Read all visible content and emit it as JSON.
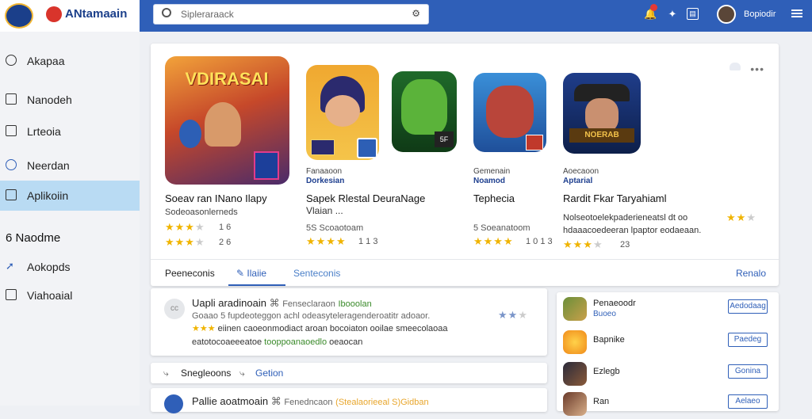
{
  "header": {
    "app_name": "ANtamaain",
    "search_placeholder": "Sipleraraack",
    "username": "Bopiodir",
    "icons": [
      "notification-bell-icon",
      "chat-icon",
      "inbox-icon",
      "menu-icon"
    ],
    "accent_color": "#2f5fb8"
  },
  "sidebar": {
    "items": [
      {
        "label": "Akapaa",
        "icon": "home-icon"
      },
      {
        "label": "Nanodeh",
        "icon": "grid-icon"
      },
      {
        "label": "Lrteoia",
        "icon": "list-icon"
      },
      {
        "label": "Neerdan",
        "icon": "clock-icon"
      },
      {
        "label": "Aplikoiin",
        "icon": "app-icon",
        "active": true
      }
    ],
    "section_heading": "6 Naodme",
    "section_items": [
      {
        "label": "Aokopds",
        "icon": "pin-icon"
      },
      {
        "label": "Viahoaial",
        "icon": "doc-icon"
      }
    ]
  },
  "featured": {
    "apps": [
      {
        "thumb_text": "VDIRASAI",
        "name": "Soeav ran INano Ilapy",
        "sub": "Sodeoasonlerneds",
        "stars_a": 3,
        "meta_a": "1  6",
        "stars_b": 3,
        "meta_b": "2  6"
      },
      {
        "t1": "Fanaaoon",
        "t2": "Dorkesian",
        "name": "Sapek Rlestal DeuraNage",
        "sub": "Vlaian ...",
        "meta_a": "5S  Scoaotoam",
        "stars_b": 4,
        "meta_b": "1  1  3"
      },
      {
        "t1": "Gemenain",
        "t2": "Noamod",
        "name": "Tephecia",
        "meta_a": "5  Soeanatoom",
        "stars_b": 4,
        "meta_b": "1  0  1  3"
      },
      {
        "t1": "Aoecaoon",
        "t2": "Aptarial",
        "name": "Rardit Fkar Taryahiaml",
        "sub": "Nolseotoelekpaderieneatsl dt  oo",
        "sub2": "hdaaacoedeeran lpaptor eodaeaan.",
        "stars_a": 2,
        "stars_b": 3,
        "meta_b": "23"
      }
    ],
    "tabs": [
      {
        "label": "Peeneconis"
      },
      {
        "label": "Ilaiie",
        "active": true
      },
      {
        "label": "Senteconis"
      }
    ],
    "tab_right": "Renalo"
  },
  "reviews": [
    {
      "avatar_text": "cc",
      "title": "Uapli aradinoain",
      "badge_text": "Fenseclaraon",
      "badge_green": "Ibooolan",
      "line2": "Goaao  5  fupdeoteggon achl  odeasyteleragenderoatitr adoaor.",
      "line3_prefix": "eiinen caoeonmodiact aroan bocoiaton ooilae smeecolaoaa",
      "line4": "eatotocoaeeeatoe",
      "line4_green": "tooppoanaoedlo",
      "line4_end": "oeaocan"
    },
    {
      "title": "Pallie aoatmoain",
      "badge_text": "Fenedncaon",
      "badge_orange": "(Stealaorieeal S)Gidban"
    }
  ],
  "controls": {
    "left_label": "Snegleoons",
    "right_label": "Getion"
  },
  "sidebar_list": [
    {
      "name": "Penaeoodr",
      "sub": "Buoeo",
      "button": "Aedodaag"
    },
    {
      "name": "Bapnike",
      "sub": "",
      "button": "Paedeg"
    },
    {
      "name": "Ezlegb",
      "sub": "",
      "button": "Gonina"
    },
    {
      "name": "Ran",
      "sub": "",
      "button": "Aelaeo"
    }
  ]
}
